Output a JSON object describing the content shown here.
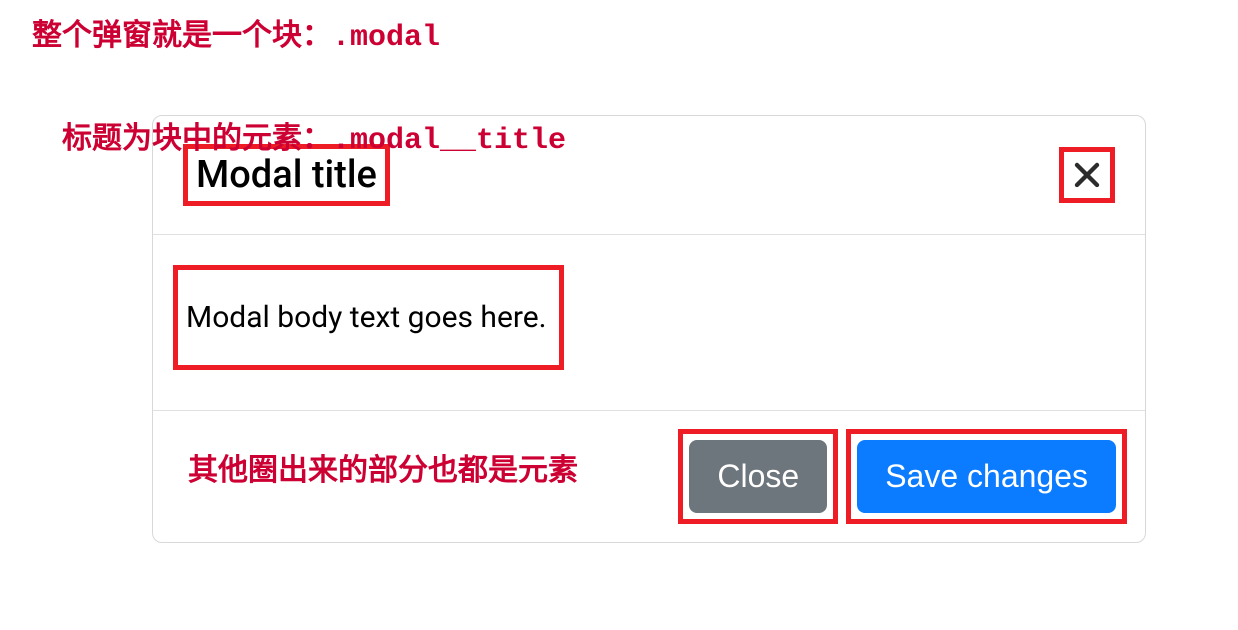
{
  "annotations": {
    "line1_text": "整个弹窗就是一个块：",
    "line1_code": ".modal",
    "line2_text": "标题为块中的元素：",
    "line2_code": ".modal__title",
    "line3_text": "其他圈出来的部分也都是元素"
  },
  "modal": {
    "title": "Modal title",
    "body": "Modal body text goes here.",
    "footer": {
      "close_label": "Close",
      "save_label": "Save changes"
    }
  },
  "colors": {
    "annotation_red": "#cc0033",
    "highlight_red": "#ee1c25",
    "close_gray": "#6d757d",
    "save_blue": "#0b7bff"
  }
}
